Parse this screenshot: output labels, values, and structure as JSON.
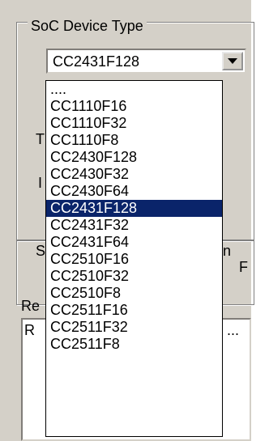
{
  "group_title": "SoC Device Type",
  "device_combo": {
    "selected": "CC2431F128"
  },
  "device_options": [
    "....",
    "CC1110F16",
    "CC1110F32",
    "CC1110F8",
    "CC2430F128",
    "CC2430F32",
    "CC2430F64",
    "CC2431F128",
    "CC2431F32",
    "CC2431F64",
    "CC2510F16",
    "CC2510F32",
    "CC2510F8",
    "CC2511F16",
    "CC2511F32",
    "CC2511F8"
  ],
  "selected_index": 7,
  "partial_labels": {
    "t": "T",
    "i": "I",
    "s": "S",
    "n": "n",
    "f": "F",
    "re": "Re",
    "r": "R",
    "ellipsis": "..."
  },
  "colors": {
    "selection": "#0a246a",
    "face": "#d4d0c8"
  }
}
